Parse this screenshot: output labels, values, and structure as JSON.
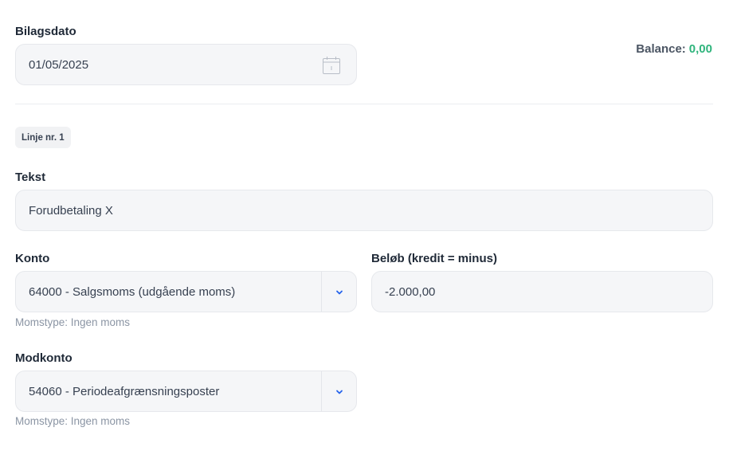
{
  "header": {
    "date_label": "Bilagsdato",
    "date_value": "01/05/2025",
    "balance_label": "Balance:",
    "balance_value": "0,00"
  },
  "line": {
    "badge": "Linje nr. 1",
    "tekst_label": "Tekst",
    "tekst_value": "Forudbetaling X",
    "konto_label": "Konto",
    "konto_value": "64000 - Salgsmoms (udgående moms)",
    "konto_hint": "Momstype: Ingen moms",
    "belob_label": "Beløb (kredit = minus)",
    "belob_value": "-2.000,00",
    "modkonto_label": "Modkonto",
    "modkonto_value": "54060 - Periodeafgrænsningsposter",
    "modkonto_hint": "Momstype: Ingen moms"
  },
  "icons": {
    "calendar": "calendar-icon",
    "dropdown": "chevron-down-icon"
  },
  "colors": {
    "balance_value": "#2fb47c",
    "chevron": "#2563eb"
  }
}
